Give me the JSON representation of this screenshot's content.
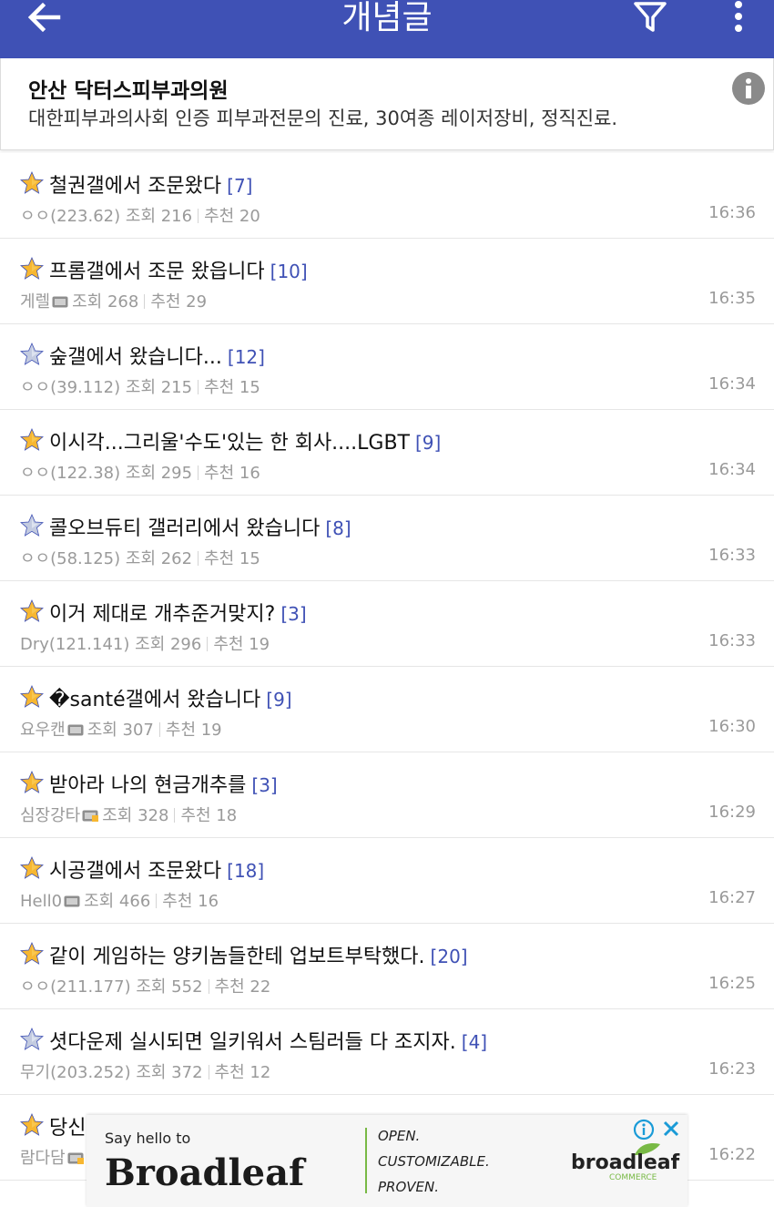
{
  "header": {
    "title": "개념글",
    "back_icon": "arrow-left-icon",
    "filter_icon": "filter-icon",
    "more_icon": "more-vert-icon",
    "color": "#3f51b5"
  },
  "sponsor": {
    "title": "안산 닥터스피부과의원",
    "description": "대한피부과의사회 인증 피부과전문의 진료, 30여종 레이저장비, 정직진료."
  },
  "posts": [
    {
      "title": "철권갤에서 조문왔다",
      "count": "[7]",
      "author": "ㅇㅇ(223.62)",
      "author_icon": "",
      "views": "조회 216",
      "recommends": "추천 20",
      "time": "16:36",
      "star": "gold"
    },
    {
      "title": "프롬갤에서 조문 왔읍니다",
      "count": "[10]",
      "author": "게렐",
      "author_icon": "fixed-nick-icon",
      "views": "조회 268",
      "recommends": "추천 29",
      "time": "16:35",
      "star": "gold"
    },
    {
      "title": "숲갤에서 왔습니다...",
      "count": "[12]",
      "author": "ㅇㅇ(39.112)",
      "author_icon": "",
      "views": "조회 215",
      "recommends": "추천 15",
      "time": "16:34",
      "star": "silver"
    },
    {
      "title": "이시각...그리울'수도'있는 한 회사....LGBT",
      "count": "[9]",
      "author": "ㅇㅇ(122.38)",
      "author_icon": "",
      "views": "조회 295",
      "recommends": "추천 16",
      "time": "16:34",
      "star": "gold"
    },
    {
      "title": "콜오브듀티 갤러리에서 왔습니다",
      "count": "[8]",
      "author": "ㅇㅇ(58.125)",
      "author_icon": "",
      "views": "조회 262",
      "recommends": "추천 15",
      "time": "16:33",
      "star": "silver"
    },
    {
      "title": "이거 제대로 개추준거맞지?",
      "count": "[3]",
      "author": "Dry(121.141)",
      "author_icon": "",
      "views": "조회 296",
      "recommends": "추천 19",
      "time": "16:33",
      "star": "gold"
    },
    {
      "title": "�santé갤에서 왔습니다",
      "count": "[9]",
      "author": "요우캔",
      "author_icon": "fixed-nick-icon",
      "views": "조회 307",
      "recommends": "추천 19",
      "time": "16:30",
      "star": "gold"
    },
    {
      "title": "받아라 나의 현금개추를",
      "count": "[3]",
      "author": "심장강타",
      "author_icon": "locked-nick-icon",
      "views": "조회 328",
      "recommends": "추천 18",
      "time": "16:29",
      "star": "gold"
    },
    {
      "title": "시공갤에서 조문왔다",
      "count": "[18]",
      "author": "Hell0",
      "author_icon": "fixed-nick-icon",
      "views": "조회 466",
      "recommends": "추천 16",
      "time": "16:27",
      "star": "gold"
    },
    {
      "title": "같이 게임하는 양키놈들한테 업보트부탁했다.",
      "count": "[20]",
      "author": "ㅇㅇ(211.177)",
      "author_icon": "",
      "views": "조회 552",
      "recommends": "추천 22",
      "time": "16:25",
      "star": "gold"
    },
    {
      "title": "셧다운제 실시되면 일키워서 스팀러들 다 조지자.",
      "count": "[4]",
      "author": "무기(203.252)",
      "author_icon": "",
      "views": "조회 372",
      "recommends": "추천 12",
      "time": "16:23",
      "star": "silver"
    },
    {
      "title": "당신",
      "count": "",
      "author": "람다담",
      "author_icon": "locked-nick-icon",
      "views": "",
      "recommends": "",
      "time": "16:22",
      "star": "gold"
    }
  ],
  "ad": {
    "hello": "Say hello to",
    "brand": "Broadleaf",
    "line1": "OPEN.",
    "line2": "CUSTOMIZABLE.",
    "line3": "PROVEN.",
    "logo": "broadleaf",
    "logo_sub": "COMMERCE",
    "info_icon": "ad-info-icon",
    "close_icon": "close-icon",
    "accent": "#78b945"
  }
}
